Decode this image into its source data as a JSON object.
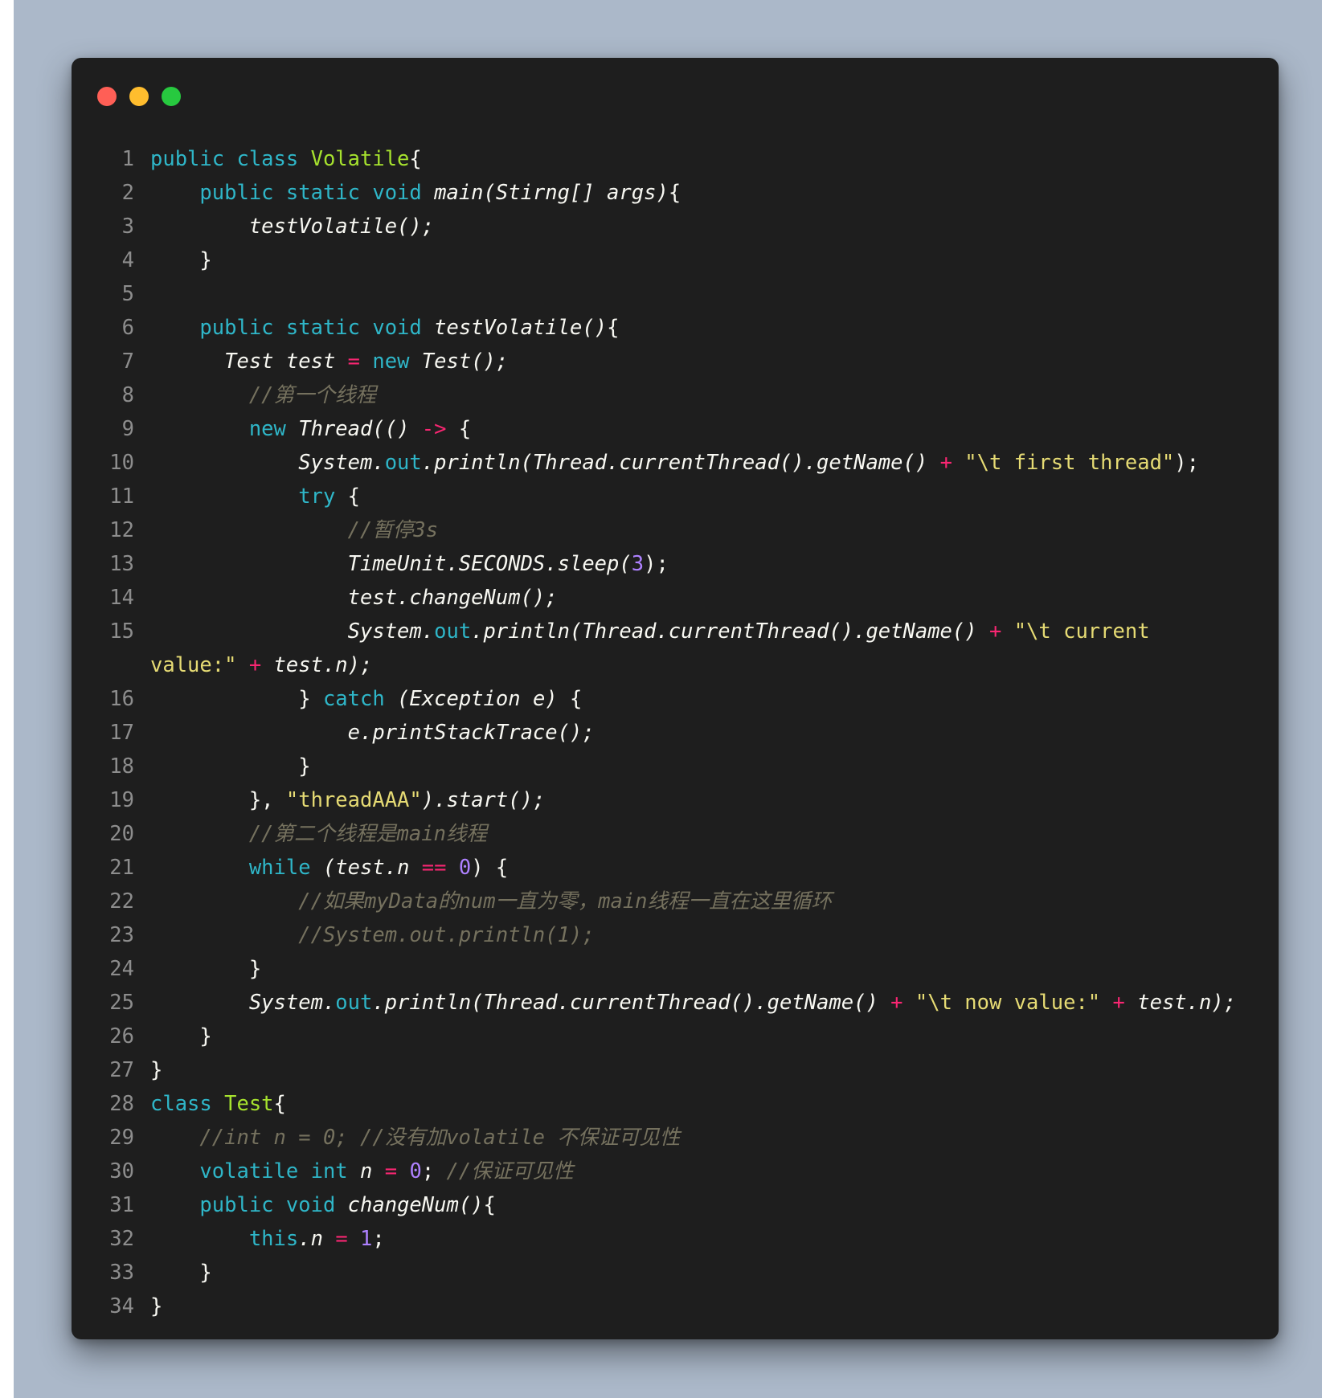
{
  "colors": {
    "background": "#abb8c9",
    "window": "#1e1e1e",
    "keyword": "#2fb6c8",
    "class_name": "#a6e22e",
    "string": "#e6db74",
    "number": "#ae81ff",
    "operator": "#f92672",
    "comment": "#75715e",
    "line_number": "#8d8d8d",
    "text": "#f8f8f2"
  },
  "window_controls": [
    "close-dot",
    "minimize-dot",
    "maximize-dot"
  ],
  "lines": [
    {
      "n": "1",
      "tokens": [
        [
          "kw",
          "public class "
        ],
        [
          "cls",
          "Volatile"
        ],
        [
          "p",
          "{"
        ]
      ]
    },
    {
      "n": "2",
      "tokens": [
        [
          "p",
          "    "
        ],
        [
          "kw",
          "public static void "
        ],
        [
          "fn",
          "main(Stirng[] args)"
        ],
        [
          "p",
          "{"
        ]
      ]
    },
    {
      "n": "3",
      "tokens": [
        [
          "p",
          "        "
        ],
        [
          "fn",
          "testVolatile();"
        ]
      ]
    },
    {
      "n": "4",
      "tokens": [
        [
          "p",
          "    }"
        ]
      ]
    },
    {
      "n": "5",
      "tokens": [
        [
          "p",
          ""
        ]
      ]
    },
    {
      "n": "6",
      "tokens": [
        [
          "p",
          "    "
        ],
        [
          "kw",
          "public static void "
        ],
        [
          "fn",
          "testVolatile()"
        ],
        [
          "p",
          "{"
        ]
      ]
    },
    {
      "n": "7",
      "tokens": [
        [
          "p",
          "      "
        ],
        [
          "fn",
          "Test test "
        ],
        [
          "op",
          "= "
        ],
        [
          "kw",
          "new "
        ],
        [
          "fn",
          "Test();"
        ]
      ]
    },
    {
      "n": "8",
      "tokens": [
        [
          "p",
          "        "
        ],
        [
          "cm",
          "//第一个线程"
        ]
      ]
    },
    {
      "n": "9",
      "tokens": [
        [
          "p",
          "        "
        ],
        [
          "kw",
          "new "
        ],
        [
          "fn",
          "Thread(() "
        ],
        [
          "op",
          "-> "
        ],
        [
          "p",
          "{"
        ]
      ]
    },
    {
      "n": "10",
      "tokens": [
        [
          "p",
          "            "
        ],
        [
          "fn",
          "System."
        ],
        [
          "kw",
          "out"
        ],
        [
          "fn",
          ".println(Thread.currentThread().getName() "
        ],
        [
          "op",
          "+ "
        ],
        [
          "str",
          "\"\\t first thread\""
        ],
        [
          "p",
          ");"
        ]
      ]
    },
    {
      "n": "11",
      "tokens": [
        [
          "p",
          "            "
        ],
        [
          "kw",
          "try "
        ],
        [
          "p",
          "{"
        ]
      ]
    },
    {
      "n": "12",
      "tokens": [
        [
          "p",
          "                "
        ],
        [
          "cm",
          "//暂停3s"
        ]
      ]
    },
    {
      "n": "13",
      "tokens": [
        [
          "p",
          "                "
        ],
        [
          "fn",
          "TimeUnit.SECONDS.sleep("
        ],
        [
          "num",
          "3"
        ],
        [
          "p",
          ");"
        ]
      ]
    },
    {
      "n": "14",
      "tokens": [
        [
          "p",
          "                "
        ],
        [
          "fn",
          "test.changeNum();"
        ]
      ]
    },
    {
      "n": "15",
      "tokens": [
        [
          "p",
          "                "
        ],
        [
          "fn",
          "System."
        ],
        [
          "kw",
          "out"
        ],
        [
          "fn",
          ".println(Thread.currentThread().getName() "
        ],
        [
          "op",
          "+ "
        ],
        [
          "str",
          "\"\\t current"
        ]
      ]
    },
    {
      "n": "",
      "tokens": [
        [
          "str",
          "value:\" "
        ],
        [
          "op",
          "+ "
        ],
        [
          "fn",
          "test.n);"
        ]
      ]
    },
    {
      "n": "16",
      "tokens": [
        [
          "p",
          "            } "
        ],
        [
          "kw",
          "catch "
        ],
        [
          "fn",
          "(Exception e) "
        ],
        [
          "p",
          "{"
        ]
      ]
    },
    {
      "n": "17",
      "tokens": [
        [
          "p",
          "                "
        ],
        [
          "fn",
          "e.printStackTrace();"
        ]
      ]
    },
    {
      "n": "18",
      "tokens": [
        [
          "p",
          "            }"
        ]
      ]
    },
    {
      "n": "19",
      "tokens": [
        [
          "p",
          "        }, "
        ],
        [
          "str",
          "\"threadAAA\""
        ],
        [
          "fn",
          ").start();"
        ]
      ]
    },
    {
      "n": "20",
      "tokens": [
        [
          "p",
          "        "
        ],
        [
          "cm",
          "//第二个线程是main线程"
        ]
      ]
    },
    {
      "n": "21",
      "tokens": [
        [
          "p",
          "        "
        ],
        [
          "kw",
          "while "
        ],
        [
          "fn",
          "(test.n "
        ],
        [
          "op",
          "== "
        ],
        [
          "num",
          "0"
        ],
        [
          "p",
          ") {"
        ]
      ]
    },
    {
      "n": "22",
      "tokens": [
        [
          "p",
          "            "
        ],
        [
          "cm",
          "//如果myData的num一直为零，main线程一直在这里循环"
        ]
      ]
    },
    {
      "n": "23",
      "tokens": [
        [
          "p",
          "            "
        ],
        [
          "cm",
          "//System.out.println(1);"
        ]
      ]
    },
    {
      "n": "24",
      "tokens": [
        [
          "p",
          "        }"
        ]
      ]
    },
    {
      "n": "25",
      "tokens": [
        [
          "p",
          "        "
        ],
        [
          "fn",
          "System."
        ],
        [
          "kw",
          "out"
        ],
        [
          "fn",
          ".println(Thread.currentThread().getName() "
        ],
        [
          "op",
          "+ "
        ],
        [
          "str",
          "\"\\t now value:\" "
        ],
        [
          "op",
          "+ "
        ],
        [
          "fn",
          "test.n);"
        ]
      ]
    },
    {
      "n": "26",
      "tokens": [
        [
          "p",
          "    }"
        ]
      ]
    },
    {
      "n": "27",
      "tokens": [
        [
          "p",
          "}"
        ]
      ]
    },
    {
      "n": "28",
      "tokens": [
        [
          "kw",
          "class "
        ],
        [
          "cls",
          "Test"
        ],
        [
          "p",
          "{"
        ]
      ]
    },
    {
      "n": "29",
      "tokens": [
        [
          "p",
          "    "
        ],
        [
          "cm",
          "//int n = 0; //没有加volatile 不保证可见性"
        ]
      ]
    },
    {
      "n": "30",
      "tokens": [
        [
          "p",
          "    "
        ],
        [
          "kw",
          "volatile int "
        ],
        [
          "fn",
          "n "
        ],
        [
          "op",
          "= "
        ],
        [
          "num",
          "0"
        ],
        [
          "p",
          "; "
        ],
        [
          "cm",
          "//保证可见性"
        ]
      ]
    },
    {
      "n": "31",
      "tokens": [
        [
          "p",
          "    "
        ],
        [
          "kw",
          "public void "
        ],
        [
          "fn",
          "changeNum()"
        ],
        [
          "p",
          "{"
        ]
      ]
    },
    {
      "n": "32",
      "tokens": [
        [
          "p",
          "        "
        ],
        [
          "kw",
          "this"
        ],
        [
          "fn",
          ".n "
        ],
        [
          "op",
          "= "
        ],
        [
          "num",
          "1"
        ],
        [
          "p",
          ";"
        ]
      ]
    },
    {
      "n": "33",
      "tokens": [
        [
          "p",
          "    }"
        ]
      ]
    },
    {
      "n": "34",
      "tokens": [
        [
          "p",
          "}"
        ]
      ]
    }
  ]
}
